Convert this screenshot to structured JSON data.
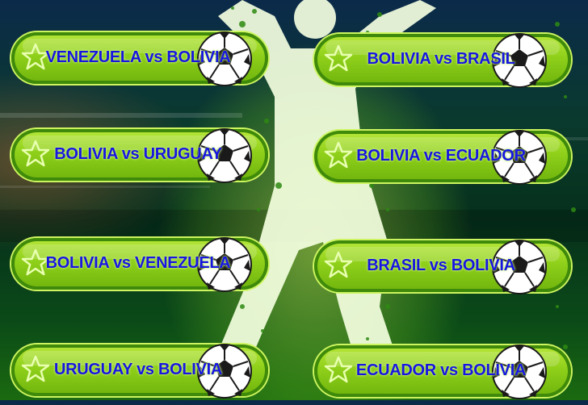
{
  "matches": [
    {
      "label": "VENEZUELA vs BOLIVIA"
    },
    {
      "label": "BOLIVIA vs BRASIL"
    },
    {
      "label": "BOLIVIA vs URUGUAY"
    },
    {
      "label": "BOLIVIA vs ECUADOR"
    },
    {
      "label": "BOLIVIA vs VENEZUELA"
    },
    {
      "label": "BRASIL vs BOLIVIA"
    },
    {
      "label": "URUGUAY vs BOLIVIA"
    },
    {
      "label": "ECUADOR vs BOLIVIA"
    }
  ],
  "icons": {
    "button_star": "star-icon",
    "button_ball": "soccer-ball-icon",
    "background_figure": "player-silhouette"
  },
  "colors": {
    "label": "#1616e0",
    "button_green": "#8fd01a",
    "button_border": "#3f8a0a"
  }
}
